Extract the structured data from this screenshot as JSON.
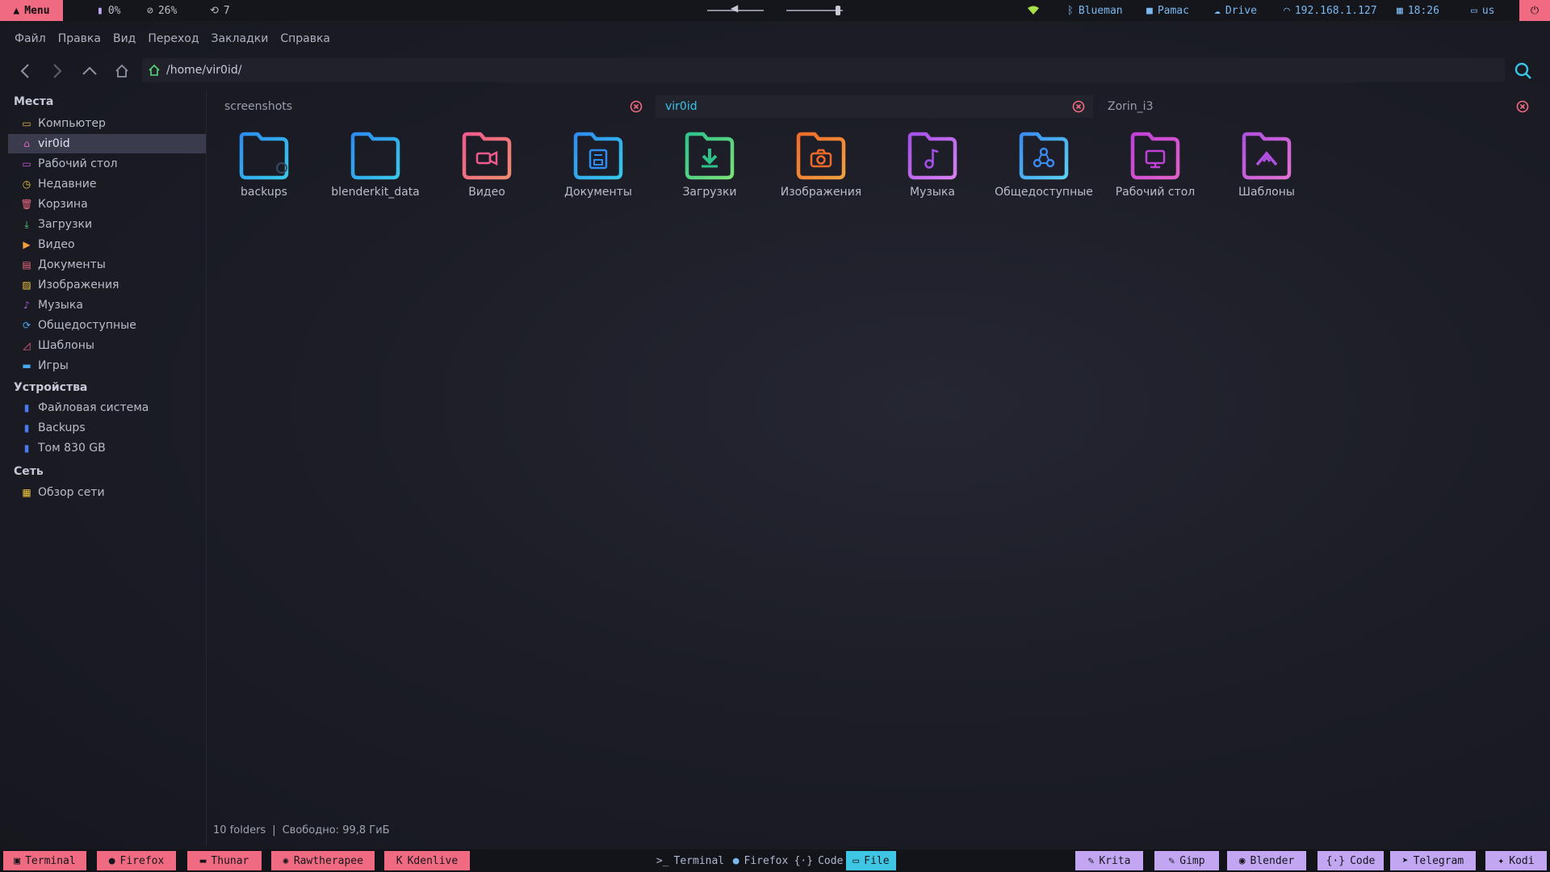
{
  "colors": {
    "accent_pink": "#f06b82",
    "accent_lavender": "#c3a6f2",
    "accent_cyan": "#3fc6e4"
  },
  "topbar": {
    "menu_label": "Menu",
    "memory": "0%",
    "cpu": "26%",
    "updates": "7",
    "volume_level": 0.5,
    "brightness_level": 0.92,
    "bluetooth": "Blueman",
    "pamac": "Pamac",
    "drive": "Drive",
    "ip": "192.168.1.127",
    "time": "18:26",
    "layout": "us"
  },
  "menubar": [
    "Файл",
    "Правка",
    "Вид",
    "Переход",
    "Закладки",
    "Справка"
  ],
  "location": {
    "path": "/home/vir0id/"
  },
  "sidebar": {
    "places_title": "Места",
    "places": [
      {
        "label": "Компьютер",
        "icon": "computer-icon",
        "color": "#e8b04a"
      },
      {
        "label": "vir0id",
        "icon": "home-icon",
        "color": "#e064c8"
      },
      {
        "label": "Рабочий стол",
        "icon": "desktop-icon",
        "color": "#c35de0"
      },
      {
        "label": "Недавние",
        "icon": "clock-icon",
        "color": "#f0c640"
      },
      {
        "label": "Корзина",
        "icon": "trash-icon",
        "color": "#f06b82"
      },
      {
        "label": "Загрузки",
        "icon": "download-icon",
        "color": "#5ad67a"
      },
      {
        "label": "Видео",
        "icon": "video-icon",
        "color": "#f0a040"
      },
      {
        "label": "Документы",
        "icon": "document-icon",
        "color": "#f06b82"
      },
      {
        "label": "Изображения",
        "icon": "image-icon",
        "color": "#f0c640"
      },
      {
        "label": "Музыка",
        "icon": "music-icon",
        "color": "#b05ae0"
      },
      {
        "label": "Общедоступные",
        "icon": "share-icon",
        "color": "#4aa8f0"
      },
      {
        "label": "Шаблоны",
        "icon": "template-icon",
        "color": "#f06b82"
      },
      {
        "label": "Игры",
        "icon": "folder-icon",
        "color": "#4aa8f0"
      }
    ],
    "devices_title": "Устройства",
    "devices": [
      {
        "label": "Файловая система",
        "icon": "drive-icon",
        "color": "#4a7af0"
      },
      {
        "label": "Backups",
        "icon": "drive-icon",
        "color": "#4a7af0"
      },
      {
        "label": "Том 830 GB",
        "icon": "drive-icon",
        "color": "#4a7af0"
      }
    ],
    "network_title": "Сеть",
    "network": [
      {
        "label": "Обзор сети",
        "icon": "network-icon",
        "color": "#f0c640"
      }
    ]
  },
  "tabs": [
    {
      "label": "screenshots"
    },
    {
      "label": "vir0id"
    },
    {
      "label": "Zorin_i3"
    }
  ],
  "folders": [
    {
      "label": "backups",
      "icon": "folder-backup-icon",
      "c1": "#2d8cf0",
      "c2": "#38c8e8"
    },
    {
      "label": "blenderkit_data",
      "icon": "folder-icon",
      "c1": "#2d8cf0",
      "c2": "#38c8e8"
    },
    {
      "label": "Видео",
      "icon": "folder-video-icon",
      "c1": "#f05a8c",
      "c2": "#f08a70"
    },
    {
      "label": "Документы",
      "icon": "folder-documents-icon",
      "c1": "#2d8cf0",
      "c2": "#38c8e8"
    },
    {
      "label": "Загрузки",
      "icon": "folder-download-icon",
      "c1": "#2ec28a",
      "c2": "#7ae07a"
    },
    {
      "label": "Изображения",
      "icon": "folder-pictures-icon",
      "c1": "#f06a2a",
      "c2": "#f0a040"
    },
    {
      "label": "Музыка",
      "icon": "folder-music-icon",
      "c1": "#a450e8",
      "c2": "#d880f0"
    },
    {
      "label": "Общедоступные",
      "icon": "folder-public-icon",
      "c1": "#3a8cf0",
      "c2": "#5ad0f0"
    },
    {
      "label": "Рабочий стол",
      "icon": "folder-desktop-icon",
      "c1": "#c040d8",
      "c2": "#e060c8"
    },
    {
      "label": "Шаблоны",
      "icon": "folder-templates-icon",
      "c1": "#b050e0",
      "c2": "#e070d0"
    }
  ],
  "status": {
    "count": "10 folders",
    "sep": "|",
    "free": "Свободно: 99,8 ГиБ"
  },
  "bottombar": {
    "left": [
      "Terminal",
      "Firefox",
      "Thunar",
      "Rawtherapee",
      "Kdenlive"
    ],
    "center": [
      "Terminal",
      "Firefox",
      "Code",
      "File"
    ],
    "right": [
      "Krita",
      "Gimp",
      "Blender",
      "Code",
      "Telegram",
      "Kodi"
    ]
  }
}
